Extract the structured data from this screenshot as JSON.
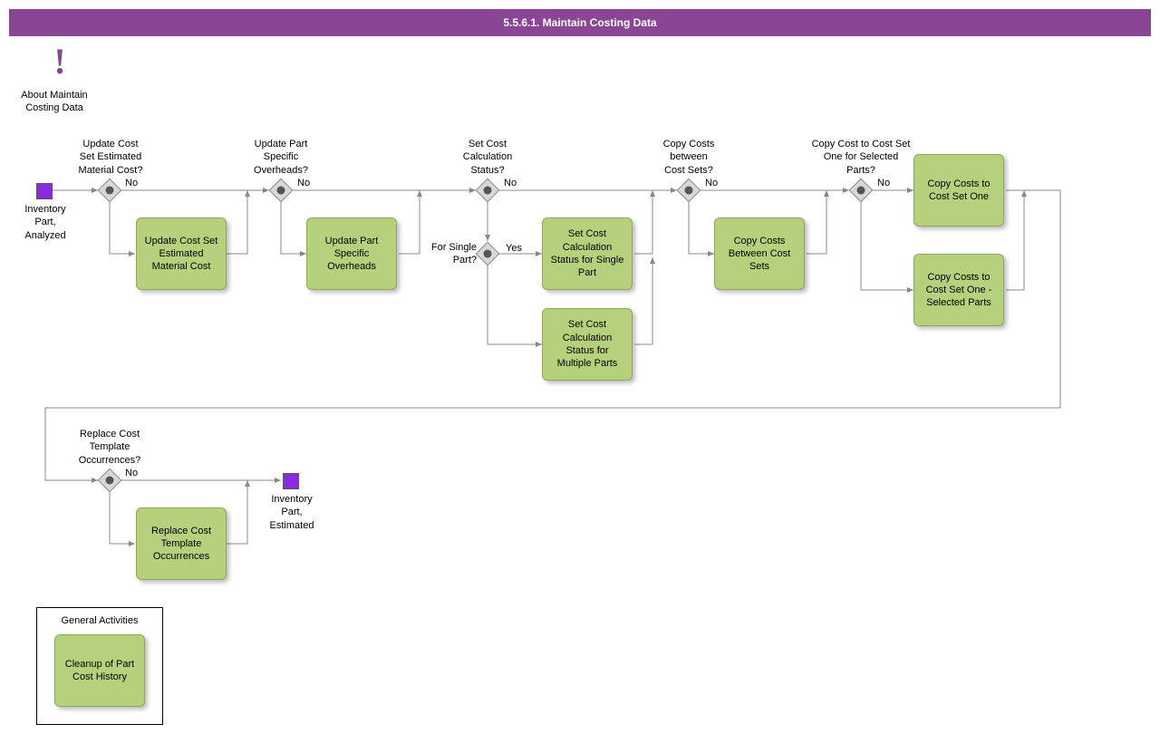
{
  "title": "5.5.6.1. Maintain Costing Data",
  "about_label": "About Maintain\nCosting Data",
  "start_label": "Inventory\nPart,\nAnalyzed",
  "end_label": "Inventory\nPart,\nEstimated",
  "gateways": {
    "g1": "Update Cost\nSet Estimated\nMaterial Cost?",
    "g2": "Update Part\nSpecific\nOverheads?",
    "g3": "Set Cost\nCalculation\nStatus?",
    "g3b": "For Single\nPart?",
    "g4": "Copy Costs\nbetween\nCost Sets?",
    "g5": "Copy Cost to Cost Set\nOne for Selected\nParts?",
    "g6": "Replace Cost\nTemplate\nOccurrences?"
  },
  "edge_labels": {
    "no": "No",
    "yes": "Yes"
  },
  "activities": {
    "a1": "Update Cost Set\nEstimated\nMaterial Cost",
    "a2": "Update Part\nSpecific\nOverheads",
    "a3s": "Set Cost\nCalculation\nStatus for Single\nPart",
    "a3m": "Set Cost\nCalculation\nStatus for\nMultiple Parts",
    "a4": "Copy Costs\nBetween Cost\nSets",
    "a5a": "Copy Costs to\nCost Set One",
    "a5b": "Copy Costs to\nCost Set One -\nSelected Parts",
    "a6": "Replace Cost\nTemplate\nOccurrences",
    "ga": "Cleanup of Part\nCost History"
  },
  "group_title": "General Activities"
}
